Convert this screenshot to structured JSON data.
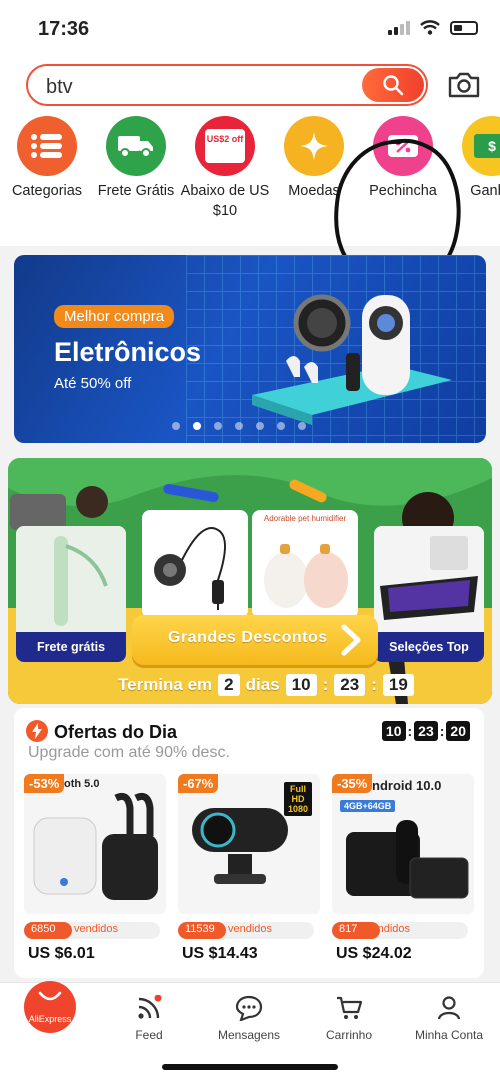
{
  "status": {
    "time": "17:36"
  },
  "search": {
    "query": "btv"
  },
  "categories": [
    {
      "label": "Categorias",
      "icon": "list-icon",
      "color": "#f0602e"
    },
    {
      "label": "Frete Grátis",
      "icon": "truck-icon",
      "color": "#2fa34a"
    },
    {
      "label": "Abaixo de US $10",
      "icon": "coupon-icon",
      "color": "#e8243a",
      "badge": "US$2 off"
    },
    {
      "label": "Moedas",
      "icon": "star-coin-icon",
      "color": "#f6b321"
    },
    {
      "label": "Pechincha",
      "icon": "discount-tag-icon",
      "color": "#f0428c"
    },
    {
      "label": "Ganhe",
      "icon": "money-icon",
      "color": "#f6c521"
    }
  ],
  "banner": {
    "badge": "Melhor compra",
    "title": "Eletrônicos",
    "subtitle": "Até 50% off",
    "dot_count": 7,
    "active_dot": 1
  },
  "promo": {
    "left_label": "Frete grátis",
    "right_label": "Seleções Top",
    "cta": "Grandes Descontos",
    "mid_caption": "Adorable pet humidifier",
    "countdown": {
      "prefix": "Termina em",
      "days": "2",
      "days_label": "dias",
      "h": "10",
      "m": "23",
      "s": "19"
    }
  },
  "deals": {
    "title": "Ofertas do Dia",
    "subtitle": "Upgrade com até 90% desc.",
    "timer": {
      "h": "10",
      "m": "23",
      "s": "20"
    },
    "products": [
      {
        "discount": "-53%",
        "sold": "6850",
        "sold_label": "vendidos",
        "price": "US $6.01",
        "caption": "oth 5.0"
      },
      {
        "discount": "-67%",
        "sold": "11539",
        "sold_label": "vendidos",
        "price": "US $14.43",
        "caption": "Full HD 1080"
      },
      {
        "discount": "-35%",
        "sold": "817",
        "sold_label": "vendidos",
        "price": "US $24.02",
        "caption": "ndroid 10.0",
        "caption2": "4GB+64GB"
      }
    ]
  },
  "nav": {
    "home": "AliExpress",
    "feed": "Feed",
    "messages": "Mensagens",
    "cart": "Carrinho",
    "account": "Minha Conta"
  }
}
